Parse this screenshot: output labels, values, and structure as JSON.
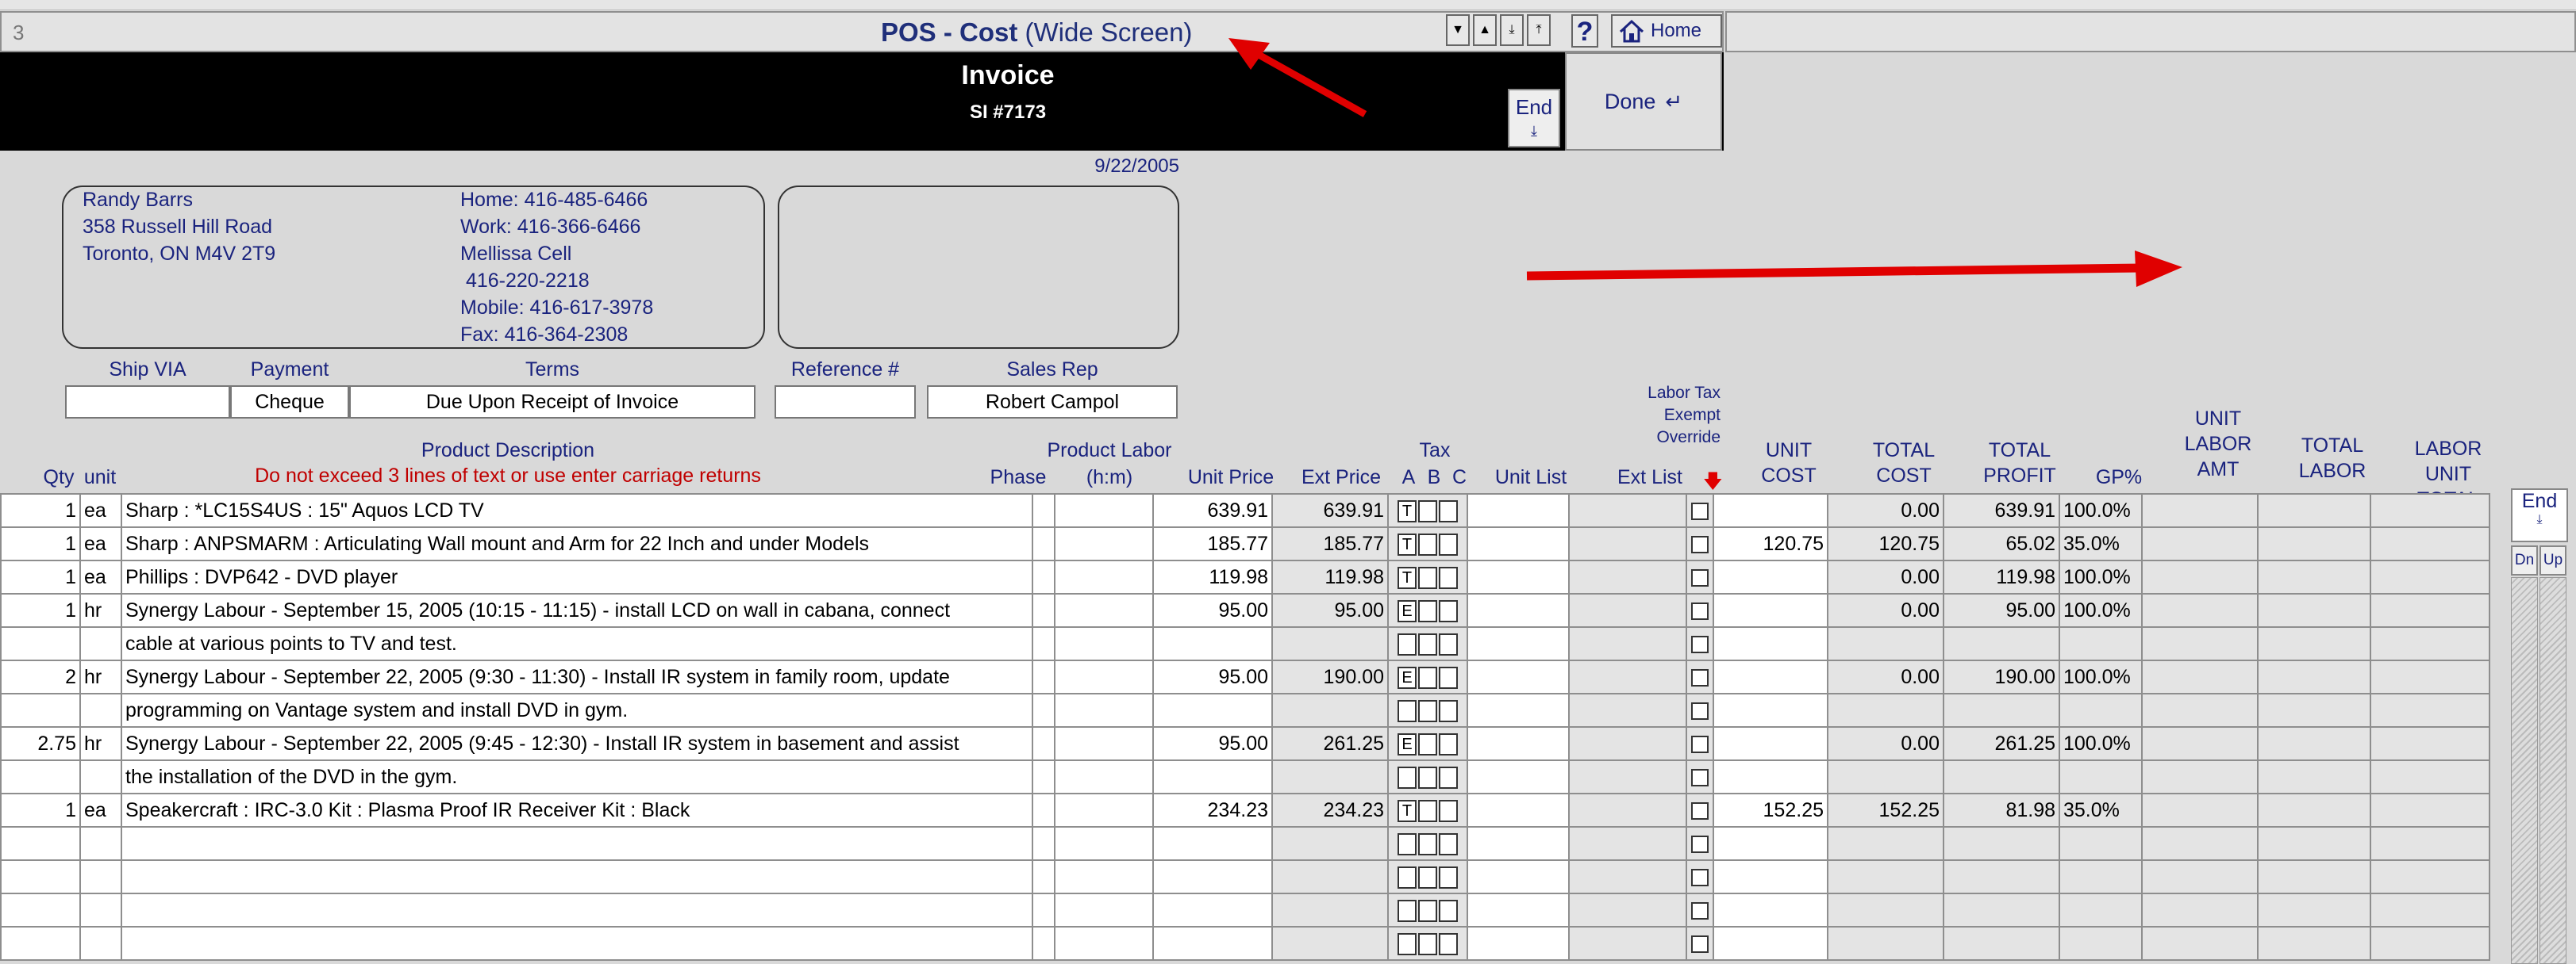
{
  "window": {
    "row_number": "3",
    "title_bold": "POS - Cost",
    "title_rest": "(Wide Screen)",
    "help_label": "?",
    "home_label": "Home"
  },
  "header": {
    "document_title": "Invoice",
    "invoice_number": "SI #7173",
    "end_label": "End",
    "done_label": "Done",
    "date": "9/22/2005"
  },
  "customer": {
    "name": "Randy Barrs",
    "street": "358 Russell Hill Road",
    "city": "Toronto, ON M4V 2T9",
    "phones": [
      "Home: 416-485-6466",
      "Work: 416-366-6466",
      "Mellissa Cell",
      " 416-220-2218",
      "Mobile: 416-617-3978",
      "Fax: 416-364-2308"
    ]
  },
  "order_fields": {
    "ship_via_label": "Ship VIA",
    "ship_via": "",
    "payment_label": "Payment",
    "payment": "Cheque",
    "terms_label": "Terms",
    "terms": "Due Upon Receipt of Invoice",
    "reference_label": "Reference #",
    "reference": "",
    "sales_rep_label": "Sales Rep",
    "sales_rep": "Robert Campol"
  },
  "columns": {
    "qty": "Qty",
    "unit": "unit",
    "description": "Product Description",
    "description_note": "Do not exceed 3 lines of text or use enter carriage returns",
    "phase": "Phase",
    "product_labor": "Product Labor",
    "hm": "(h:m)",
    "unit_price": "Unit Price",
    "ext_price": "Ext Price",
    "tax": "Tax",
    "tax_a": "A",
    "tax_b": "B",
    "tax_c": "C",
    "unit_list": "Unit List",
    "ext_list": "Ext List",
    "labor_tax_1": "Labor Tax",
    "labor_tax_2": "Exempt",
    "labor_tax_3": "Override",
    "unit_cost_1": "UNIT",
    "unit_cost_2": "COST",
    "total_cost_1": "TOTAL",
    "total_cost_2": "COST",
    "total_profit_1": "TOTAL",
    "total_profit_2": "PROFIT",
    "gp": "GP%",
    "unit_labor_1": "UNIT",
    "unit_labor_2": "LABOR",
    "unit_labor_3": "AMT",
    "total_labor_1": "TOTAL",
    "total_labor_2": "LABOR",
    "labor_unit_total_1": "LABOR UNIT",
    "labor_unit_total_2": "TOTAL"
  },
  "side_controls": {
    "end": "End",
    "dn": "Dn",
    "up": "Up"
  },
  "rows": [
    {
      "qty": "1",
      "unit": "ea",
      "desc": "Sharp : *LC15S4US : 15\" Aquos LCD TV",
      "unit_price": "639.91",
      "ext_price": "639.91",
      "tax": "T",
      "unit_cost": "",
      "total_cost": "0.00",
      "total_profit": "639.91",
      "gp": "100.0%"
    },
    {
      "qty": "1",
      "unit": "ea",
      "desc": "Sharp : ANPSMARM  : Articulating Wall mount and Arm for 22 Inch and under Models",
      "unit_price": "185.77",
      "ext_price": "185.77",
      "tax": "T",
      "unit_cost": "120.75",
      "total_cost": "120.75",
      "total_profit": "65.02",
      "gp": "35.0%"
    },
    {
      "qty": "1",
      "unit": "ea",
      "desc": "Phillips : DVP642 - DVD player",
      "unit_price": "119.98",
      "ext_price": "119.98",
      "tax": "T",
      "unit_cost": "",
      "total_cost": "0.00",
      "total_profit": "119.98",
      "gp": "100.0%"
    },
    {
      "qty": "1",
      "unit": "hr",
      "desc": "Synergy Labour - September 15, 2005 (10:15 - 11:15) - install LCD on wall in cabana, connect",
      "unit_price": "95.00",
      "ext_price": "95.00",
      "tax": "E",
      "unit_cost": "",
      "total_cost": "0.00",
      "total_profit": "95.00",
      "gp": "100.0%"
    },
    {
      "qty": "",
      "unit": "",
      "desc": "cable at various points to TV and test.",
      "unit_price": "",
      "ext_price": "",
      "tax": "",
      "unit_cost": "",
      "total_cost": "",
      "total_profit": "",
      "gp": ""
    },
    {
      "qty": "2",
      "unit": "hr",
      "desc": "Synergy Labour - September 22, 2005 (9:30 - 11:30) - Install IR system in family room, update",
      "unit_price": "95.00",
      "ext_price": "190.00",
      "tax": "E",
      "unit_cost": "",
      "total_cost": "0.00",
      "total_profit": "190.00",
      "gp": "100.0%"
    },
    {
      "qty": "",
      "unit": "",
      "desc": "programming on Vantage system and install DVD in gym.",
      "unit_price": "",
      "ext_price": "",
      "tax": "",
      "unit_cost": "",
      "total_cost": "",
      "total_profit": "",
      "gp": ""
    },
    {
      "qty": "2.75",
      "unit": "hr",
      "desc": "Synergy Labour - September 22, 2005 (9:45 - 12:30) - Install IR system in basement and assist",
      "unit_price": "95.00",
      "ext_price": "261.25",
      "tax": "E",
      "unit_cost": "",
      "total_cost": "0.00",
      "total_profit": "261.25",
      "gp": "100.0%"
    },
    {
      "qty": "",
      "unit": "",
      "desc": "the installation of the DVD in the gym.",
      "unit_price": "",
      "ext_price": "",
      "tax": "",
      "unit_cost": "",
      "total_cost": "",
      "total_profit": "",
      "gp": ""
    },
    {
      "qty": "1",
      "unit": "ea",
      "desc": "Speakercraft : IRC-3.0 Kit : Plasma Proof IR Receiver Kit : Black",
      "unit_price": "234.23",
      "ext_price": "234.23",
      "tax": "T",
      "unit_cost": "152.25",
      "total_cost": "152.25",
      "total_profit": "81.98",
      "gp": "35.0%"
    },
    {
      "qty": "",
      "unit": "",
      "desc": "",
      "unit_price": "",
      "ext_price": "",
      "tax": "",
      "unit_cost": "",
      "total_cost": "",
      "total_profit": "",
      "gp": ""
    },
    {
      "qty": "",
      "unit": "",
      "desc": "",
      "unit_price": "",
      "ext_price": "",
      "tax": "",
      "unit_cost": "",
      "total_cost": "",
      "total_profit": "",
      "gp": ""
    },
    {
      "qty": "",
      "unit": "",
      "desc": "",
      "unit_price": "",
      "ext_price": "",
      "tax": "",
      "unit_cost": "",
      "total_cost": "",
      "total_profit": "",
      "gp": ""
    },
    {
      "qty": "",
      "unit": "",
      "desc": "",
      "unit_price": "",
      "ext_price": "",
      "tax": "",
      "unit_cost": "",
      "total_cost": "",
      "total_profit": "",
      "gp": ""
    }
  ],
  "colors": {
    "label_blue": "#1a237e",
    "warning_red": "#c00000",
    "arrow_red": "#e00000"
  }
}
